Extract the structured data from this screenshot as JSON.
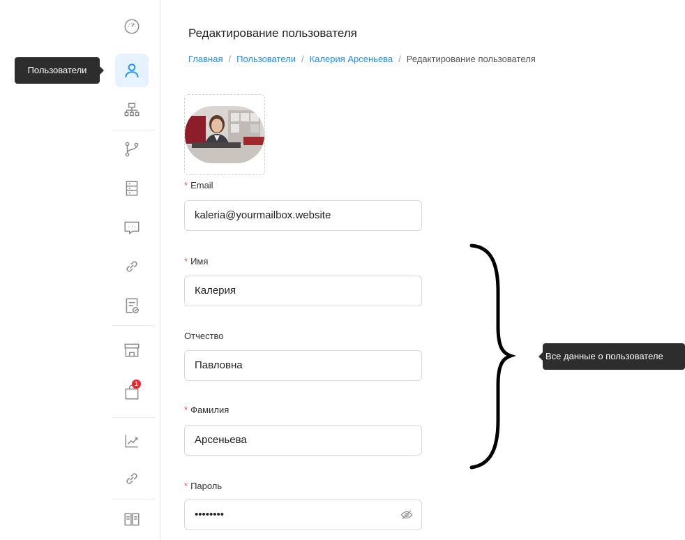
{
  "tooltips": {
    "users": "Пользователи",
    "all_data": "Все данные о пользователе"
  },
  "header": {
    "title": "Редактирование пользователя",
    "breadcrumb": [
      "Главная",
      "Пользователи",
      "Калерия Арсеньева",
      "Редактирование пользователя"
    ],
    "separator": "/"
  },
  "sidebar": {
    "items": [
      {
        "icon": "dashboard-icon"
      },
      {
        "icon": "user-icon",
        "active": true
      },
      {
        "icon": "org-structure-icon"
      },
      {
        "icon": "branch-icon"
      },
      {
        "icon": "server-icon"
      },
      {
        "icon": "chat-icon"
      },
      {
        "icon": "link-icon"
      },
      {
        "icon": "document-check-icon"
      },
      {
        "icon": "store-icon"
      },
      {
        "icon": "shopping-bag-icon",
        "badge": "1"
      },
      {
        "icon": "chart-line-icon"
      },
      {
        "icon": "link-icon"
      },
      {
        "icon": "book-icon"
      }
    ]
  },
  "form": {
    "email": {
      "label": "Email",
      "value": "kaleria@yourmailbox.website",
      "required": true
    },
    "first_name": {
      "label": "Имя",
      "value": "Калерия",
      "required": true
    },
    "patronymic": {
      "label": "Отчество",
      "value": "Павловна",
      "required": false
    },
    "last_name": {
      "label": "Фамилия",
      "value": "Арсеньева",
      "required": true
    },
    "password": {
      "label": "Пароль",
      "value": "••••••••",
      "required": true
    },
    "required_mark": "*"
  },
  "colors": {
    "accent": "#1890ff",
    "active_bg": "#e6f3ff",
    "required": "#ff4d4f",
    "badge": "#f5222d",
    "tooltip_bg": "#2d2d2d"
  }
}
